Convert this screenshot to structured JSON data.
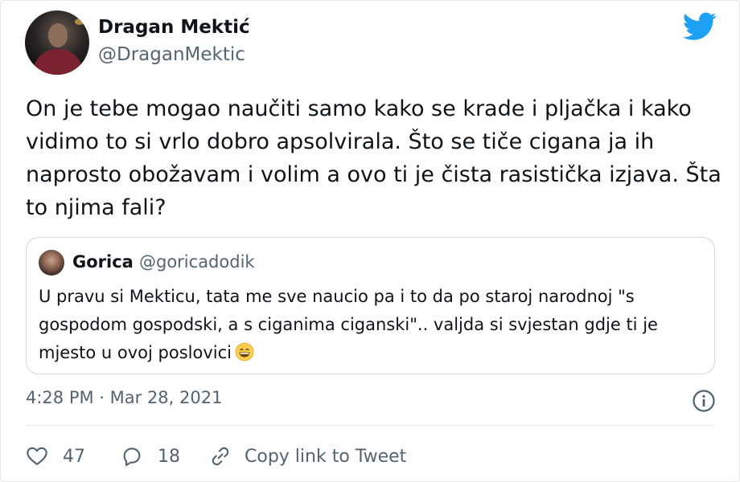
{
  "tweet": {
    "author": {
      "display_name": "Dragan Mektić",
      "handle": "@DraganMektic"
    },
    "text": "On je tebe mogao naučiti samo kako se krade i pljačka i kako vidimo to si vrlo dobro apsolvirala. Što se tiče cigana ja ih naprosto obožavam i volim a ovo ti je čista rasistička izjava. Šta to njima fali?",
    "quoted": {
      "display_name": "Gorica",
      "handle": "@goricadodik",
      "text": "U pravu si Mekticu, tata me sve naucio pa i to da po staroj narodnoj \"s gospodom gospodski, a s ciganima ciganski\".. valjda si svjestan gdje ti je mjesto u ovoj poslovici",
      "emoji": "grinning-face-emoji"
    },
    "timestamp": "4:28 PM · Mar 28, 2021",
    "likes": "47",
    "replies": "18",
    "copy_link_label": "Copy link to Tweet"
  },
  "icons": {
    "brand": "twitter-bird-icon",
    "info": "info-icon",
    "like": "heart-icon",
    "reply": "reply-bubble-icon",
    "link": "link-icon"
  },
  "colors": {
    "brand": "#1da1f2",
    "text": "#0f1419",
    "secondary": "#536471",
    "border": "#cfd9de"
  }
}
